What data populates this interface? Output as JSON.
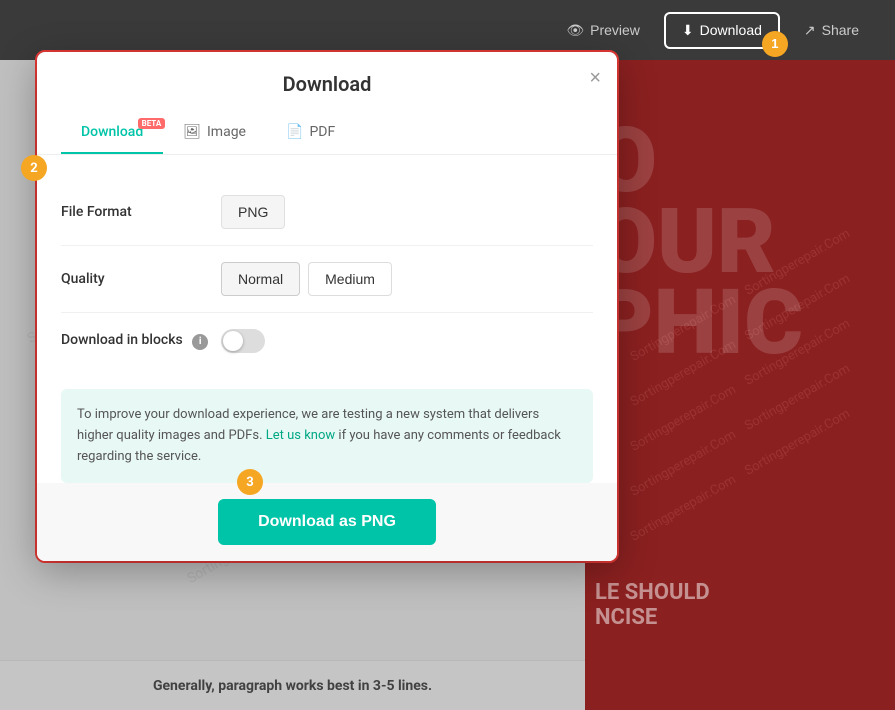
{
  "toolbar": {
    "preview_label": "Preview",
    "download_label": "Download",
    "share_label": "Share",
    "badge_1": "1"
  },
  "dialog": {
    "title": "Download",
    "close_label": "×",
    "badge_2": "2",
    "tabs": [
      {
        "id": "download",
        "label": "Download",
        "active": true,
        "beta": "BETA"
      },
      {
        "id": "image",
        "label": "Image",
        "active": false
      },
      {
        "id": "pdf",
        "label": "PDF",
        "active": false
      }
    ],
    "file_format": {
      "label": "File Format",
      "value": "PNG"
    },
    "quality": {
      "label": "Quality",
      "options": [
        {
          "label": "Normal",
          "active": true
        },
        {
          "label": "Medium",
          "active": false
        }
      ]
    },
    "download_in_blocks": {
      "label": "Download in blocks",
      "enabled": false
    },
    "info_text_before_link": "To improve your download experience, we are testing a new system that delivers higher quality images and PDFs.",
    "info_link_text": "Let us know",
    "info_text_after_link": "if you have any comments or feedback regarding the service.",
    "download_btn": "Download as PNG",
    "badge_3": "3"
  },
  "canvas": {
    "bottom_text": "Generally, paragraph works best in 3-5 lines.",
    "preview_letters": "O\nOUR\nPHIC",
    "watermark": "Sortingperepair.Com"
  }
}
